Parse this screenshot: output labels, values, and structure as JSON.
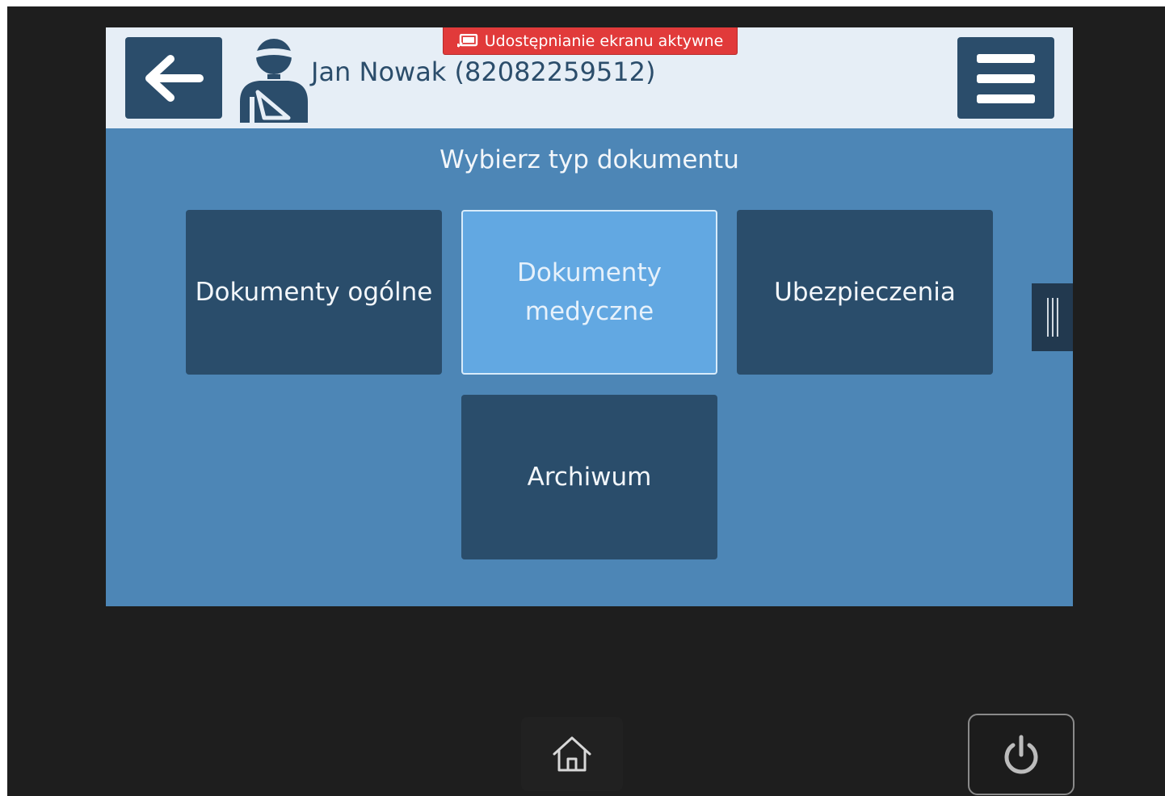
{
  "header": {
    "patient_name": "Jan Nowak (82082259512)",
    "share_banner": "Udostępnianie ekranu aktywne"
  },
  "main": {
    "title": "Wybierz typ dokumentu",
    "tiles": [
      {
        "label": "Dokumenty ogólne",
        "selected": false
      },
      {
        "label": "Dokumenty medyczne",
        "selected": true
      },
      {
        "label": "Ubezpieczenia",
        "selected": false
      },
      {
        "label": "Archiwum",
        "selected": false
      }
    ]
  },
  "icons": {
    "back": "arrow-left-icon",
    "patient": "injured-patient-icon",
    "menu": "hamburger-icon",
    "share": "screen-share-icon",
    "handle": "drag-handle-icon",
    "home": "home-icon",
    "power": "power-icon"
  },
  "colors": {
    "header_bg": "#e6eef6",
    "content_bg": "#4d86b6",
    "tile_bg": "#2a4d6b",
    "tile_selected_bg": "#62a8e2",
    "banner_bg": "#e13a3a",
    "device_bg": "#1e1e1e"
  }
}
